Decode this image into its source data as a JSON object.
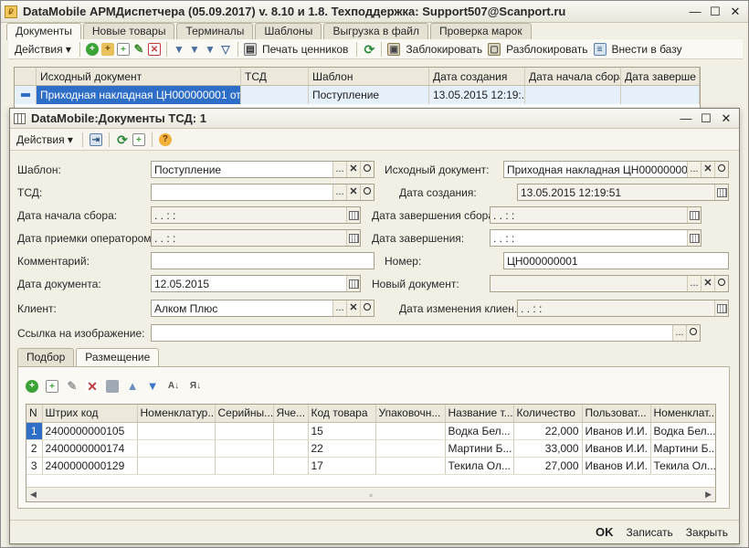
{
  "main": {
    "title": "DataMobile АРМДиспетчера (05.09.2017) v. 8.10 и 1.8. Техподдержка: Support507@Scanport.ru",
    "tabs": [
      "Документы",
      "Новые товары",
      "Терминалы",
      "Шаблоны",
      "Выгрузка в файл",
      "Проверка марок"
    ],
    "toolbar": {
      "actions": "Действия",
      "print_labels": "Печать ценников",
      "lock": "Заблокировать",
      "unlock": "Разблокировать",
      "to_db": "Внести в базу"
    },
    "grid": {
      "columns": [
        "Исходный документ",
        "ТСД",
        "Шаблон",
        "Дата создания",
        "Дата начала сбора",
        "Дата заверше"
      ],
      "row": [
        "Приходная накладная ЦН000000001 от ...",
        "",
        "Поступление",
        "13.05.2015 12:19:...",
        "",
        ""
      ]
    }
  },
  "dialog": {
    "title": "DataMobile:Документы ТСД: 1",
    "toolbar": {
      "actions": "Действия"
    },
    "form": {
      "template_label": "Шаблон:",
      "template_value": "Поступление",
      "source_doc_label": "Исходный документ:",
      "source_doc_value": "Приходная накладная ЦН000000001 от ...",
      "tsd_label": "ТСД:",
      "tsd_value": "",
      "created_label": "Дата создания:",
      "created_value": "13.05.2015 12:19:51",
      "collect_start_label": "Дата начала сбора:",
      "collect_start_value": " .  .    :  :",
      "collect_end_label": "Дата завершения сбора:",
      "collect_end_value": " .  .    :  :",
      "accept_label": "Дата приемки оператором:",
      "accept_value": " .  .    :  :",
      "finish_label": "Дата завершения:",
      "finish_value": " .  .    :  :",
      "comment_label": "Комментарий:",
      "comment_value": "",
      "number_label": "Номер:",
      "number_value": "ЦН000000001",
      "doc_date_label": "Дата документа:",
      "doc_date_value": "12.05.2015",
      "new_doc_label": "Новый документ:",
      "new_doc_value": "",
      "client_label": "Клиент:",
      "client_value": "Алком Плюс",
      "client_changed_label": "Дата изменения клиен...",
      "client_changed_value": " .  .    :  :",
      "image_link_label": "Ссылка на изображение:",
      "image_link_value": ""
    },
    "sub_tabs": [
      "Подбор",
      "Размещение"
    ],
    "table": {
      "columns": [
        "N",
        "Штрих код",
        "Номенклатур...",
        "Серийны...",
        "Яче...",
        "Код товара",
        "Упаковочн...",
        "Название т...",
        "Количество",
        "Пользоват...",
        "Номенклат..."
      ],
      "rows": [
        [
          "1",
          "2400000000105",
          "",
          "",
          "",
          "15",
          "",
          "Водка Бел...",
          "22,000",
          "Иванов И.И.",
          "Водка Бел..."
        ],
        [
          "2",
          "2400000000174",
          "",
          "",
          "",
          "22",
          "",
          "Мартини Б...",
          "33,000",
          "Иванов И.И.",
          "Мартини Б..."
        ],
        [
          "3",
          "2400000000129",
          "",
          "",
          "",
          "17",
          "",
          "Текила Ол...",
          "27,000",
          "Иванов И.И.",
          "Текила Ол..."
        ]
      ]
    },
    "footer": {
      "ok": "OK",
      "save": "Записать",
      "close": "Закрыть"
    }
  }
}
